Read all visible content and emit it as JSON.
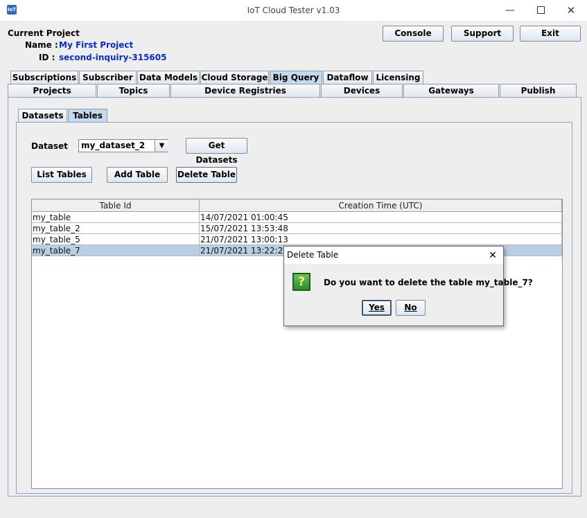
{
  "window": {
    "title": "IoT Cloud Tester v1.03",
    "app_icon_text": "IoT",
    "minimize_symbol": "—",
    "close_symbol": "✕"
  },
  "project": {
    "section_label": "Current Project",
    "name_label": "Name :",
    "name_value": "My First Project",
    "id_label": "ID :",
    "id_value": "second-inquiry-315605"
  },
  "top_buttons": {
    "console": "Console",
    "support": "Support",
    "exit": "Exit"
  },
  "tabs_row1": [
    "Subscriptions",
    "Subscriber",
    "Data Models",
    "Cloud Storage",
    "Big Query",
    "Dataflow",
    "Licensing"
  ],
  "tabs_row2": [
    "Projects",
    "Topics",
    "Device Registries",
    "Devices",
    "Gateways",
    "Publish"
  ],
  "subtabs": [
    "Datasets",
    "Tables"
  ],
  "dataset": {
    "label": "Dataset",
    "selected": "my_dataset_2",
    "get_button": "Get Datasets"
  },
  "actions": {
    "list_tables": "List Tables",
    "add_table": "Add Table",
    "delete_table": "Delete  Table"
  },
  "table": {
    "columns": [
      "Table Id",
      "Creation Time (UTC)"
    ],
    "rows": [
      {
        "id": "my_table",
        "time": "14/07/2021 01:00:45"
      },
      {
        "id": "my_table_2",
        "time": "15/07/2021 13:53:48"
      },
      {
        "id": "my_table_5",
        "time": "21/07/2021 13:00:13"
      },
      {
        "id": "my_table_7",
        "time": "21/07/2021 13:22:23"
      }
    ],
    "selected_row": 3
  },
  "dialog": {
    "title": "Delete Table",
    "close_symbol": "✕",
    "icon_glyph": "?",
    "message": "Do you want to delete the table my_table_7?",
    "yes": "Yes",
    "no": "No"
  },
  "colors": {
    "selected_tab": "#c5d9ee",
    "selected_row": "#b8cfe5",
    "project_text": "#0a2bd4"
  }
}
